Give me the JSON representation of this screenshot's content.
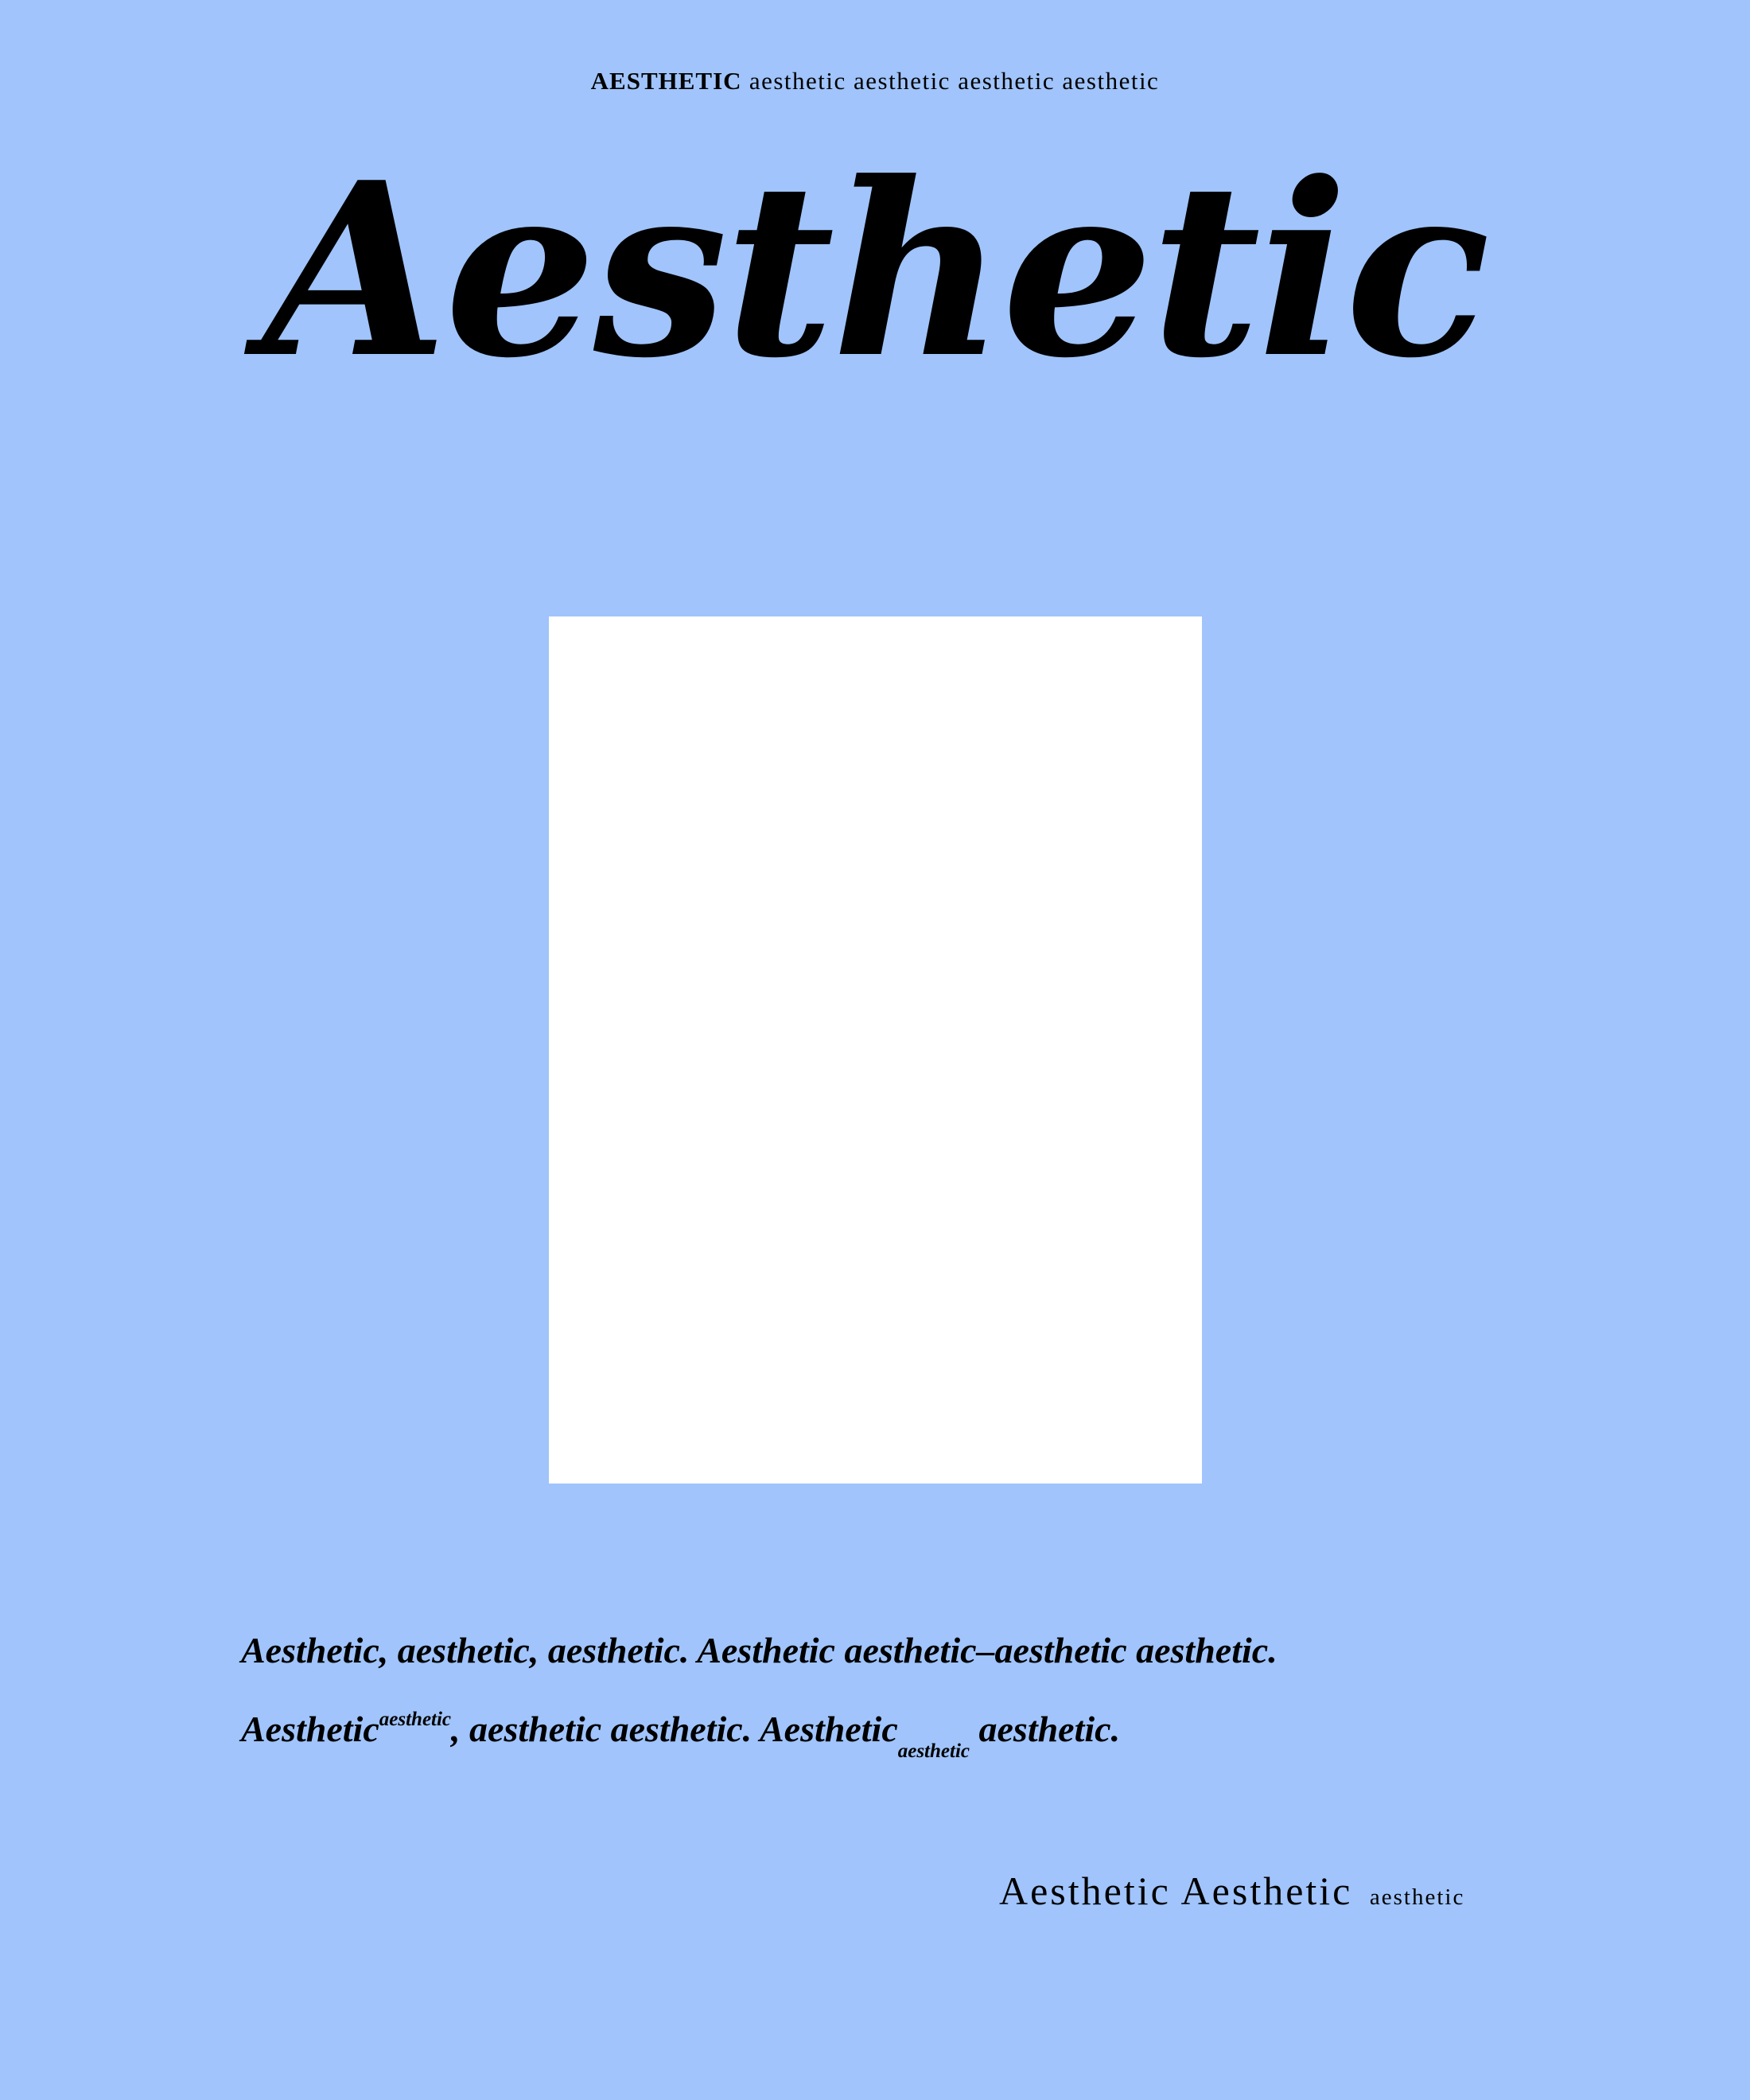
{
  "colors": {
    "background": "#a0c4fb",
    "photo_frame": "#ffffff",
    "text": "#000000"
  },
  "header": {
    "bold_word": "AESTHETIC",
    "rest": "aesthetic aesthetic aesthetic aesthetic"
  },
  "title": "Aesthetic",
  "body": {
    "line1": "Aesthetic, aesthetic, aesthetic. Aesthetic aesthetic–aesthetic aesthetic.",
    "line2_start": "Aesthetic",
    "line2_sup": "aesthetic",
    "line2_mid": ", aesthetic aesthetic. Aesthetic",
    "line2_sub": "aesthetic",
    "line2_end": " aesthetic."
  },
  "footer": {
    "main": "Aesthetic Aesthetic",
    "small": "aesthetic"
  }
}
